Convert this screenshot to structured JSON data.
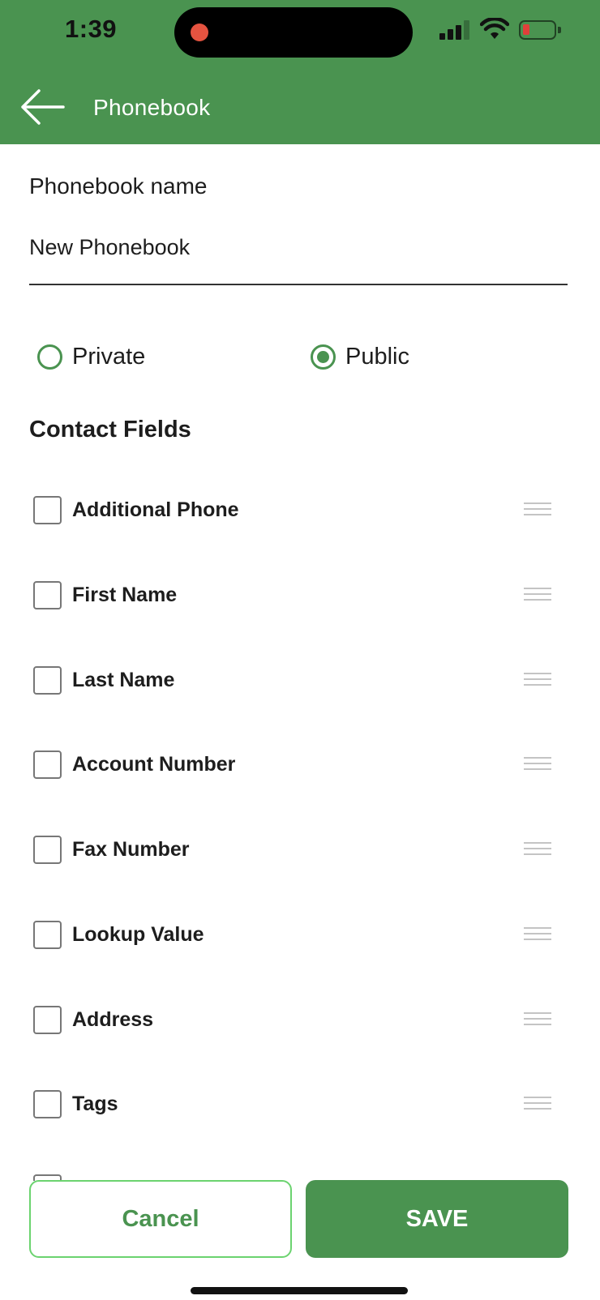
{
  "status_bar": {
    "time": "1:39"
  },
  "header": {
    "title": "Phonebook",
    "back_icon": "arrow-left-icon",
    "color": "#4a9350"
  },
  "form": {
    "name_label": "Phonebook name",
    "name_value": "New Phonebook",
    "visibility": {
      "options": [
        {
          "label": "Private",
          "selected": false
        },
        {
          "label": "Public",
          "selected": true
        }
      ]
    },
    "contact_fields_title": "Contact Fields",
    "contact_fields": [
      {
        "label": "Additional Phone",
        "checked": false
      },
      {
        "label": "First Name",
        "checked": false
      },
      {
        "label": "Last Name",
        "checked": false
      },
      {
        "label": "Account Number",
        "checked": false
      },
      {
        "label": "Fax Number",
        "checked": false
      },
      {
        "label": "Lookup Value",
        "checked": false
      },
      {
        "label": "Address",
        "checked": false
      },
      {
        "label": "Tags",
        "checked": false
      }
    ]
  },
  "actions": {
    "cancel_label": "Cancel",
    "save_label": "SAVE"
  },
  "colors": {
    "accent": "#4a9350",
    "cancel_border": "#6bd36f"
  }
}
